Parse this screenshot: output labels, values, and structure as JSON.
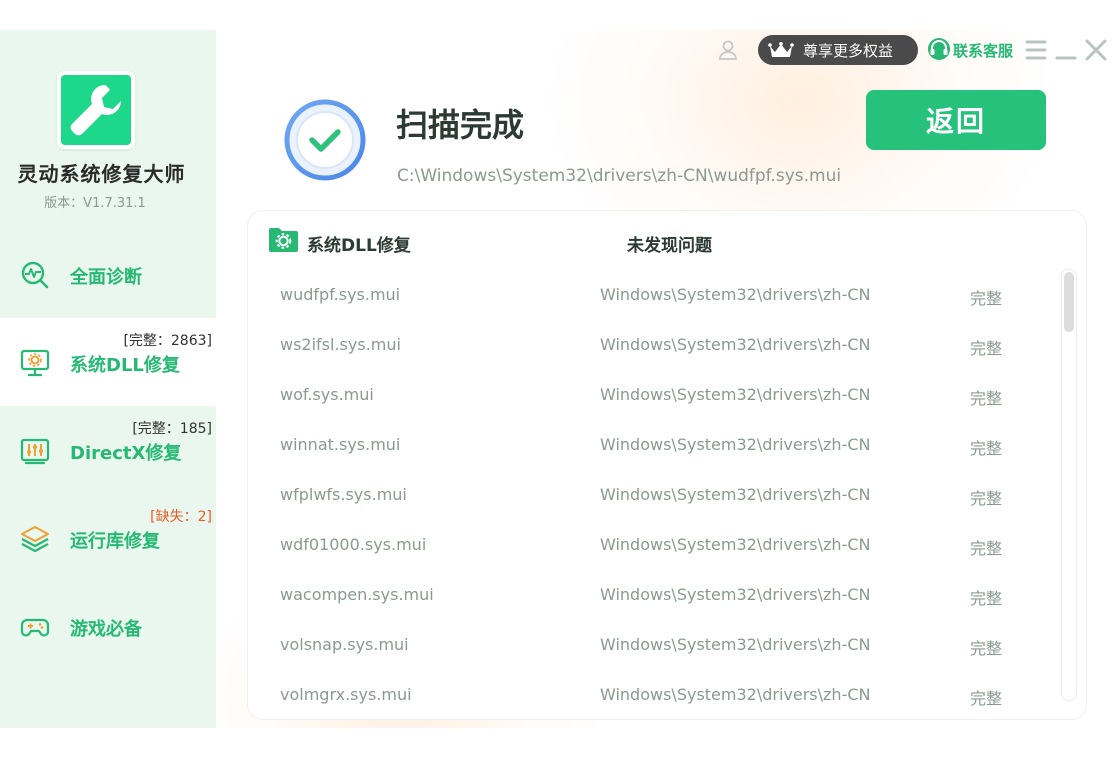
{
  "app": {
    "title": "灵动系统修复大师",
    "version": "版本：V1.7.31.1"
  },
  "topbar": {
    "vip_label": "尊享更多权益",
    "support_label": "联系客服"
  },
  "sidebar": {
    "items": [
      {
        "label": "全面诊断",
        "badge": "",
        "active": false
      },
      {
        "label": "系统DLL修复",
        "badge": "[完整：2863]",
        "active": true
      },
      {
        "label": "DirectX修复",
        "badge": "[完整：185]",
        "active": false
      },
      {
        "label": "运行库修复",
        "badge": "[缺失：2]",
        "active": false
      },
      {
        "label": "游戏必备",
        "badge": "",
        "active": false
      }
    ]
  },
  "scan": {
    "title": "扫描完成",
    "current_path": "C:\\Windows\\System32\\drivers\\zh-CN\\wudfpf.sys.mui",
    "back_label": "返回"
  },
  "results": {
    "category": "系统DLL修复",
    "status": "未发现问题",
    "rows": [
      {
        "name": "wudfpf.sys.mui",
        "path": "Windows\\System32\\drivers\\zh-CN",
        "state": "完整"
      },
      {
        "name": "ws2ifsl.sys.mui",
        "path": "Windows\\System32\\drivers\\zh-CN",
        "state": "完整"
      },
      {
        "name": "wof.sys.mui",
        "path": "Windows\\System32\\drivers\\zh-CN",
        "state": "完整"
      },
      {
        "name": "winnat.sys.mui",
        "path": "Windows\\System32\\drivers\\zh-CN",
        "state": "完整"
      },
      {
        "name": "wfplwfs.sys.mui",
        "path": "Windows\\System32\\drivers\\zh-CN",
        "state": "完整"
      },
      {
        "name": "wdf01000.sys.mui",
        "path": "Windows\\System32\\drivers\\zh-CN",
        "state": "完整"
      },
      {
        "name": "wacompen.sys.mui",
        "path": "Windows\\System32\\drivers\\zh-CN",
        "state": "完整"
      },
      {
        "name": "volsnap.sys.mui",
        "path": "Windows\\System32\\drivers\\zh-CN",
        "state": "完整"
      },
      {
        "name": "volmgrx.sys.mui",
        "path": "Windows\\System32\\drivers\\zh-CN",
        "state": "完整"
      }
    ]
  },
  "colors": {
    "brand_green": "#27b974",
    "button_green": "#26c17b",
    "sidebar_bg": "#e9f7ef",
    "warning": "#f05a24"
  },
  "icons": {
    "logo": "wrench-icon",
    "user": "user-icon",
    "vip": "crown-icon",
    "support": "headset-icon",
    "menu": "menu-icon",
    "minimize": "minimize-icon",
    "close": "close-icon",
    "scan_done": "check-circle-icon",
    "category": "folder-gear-icon"
  }
}
